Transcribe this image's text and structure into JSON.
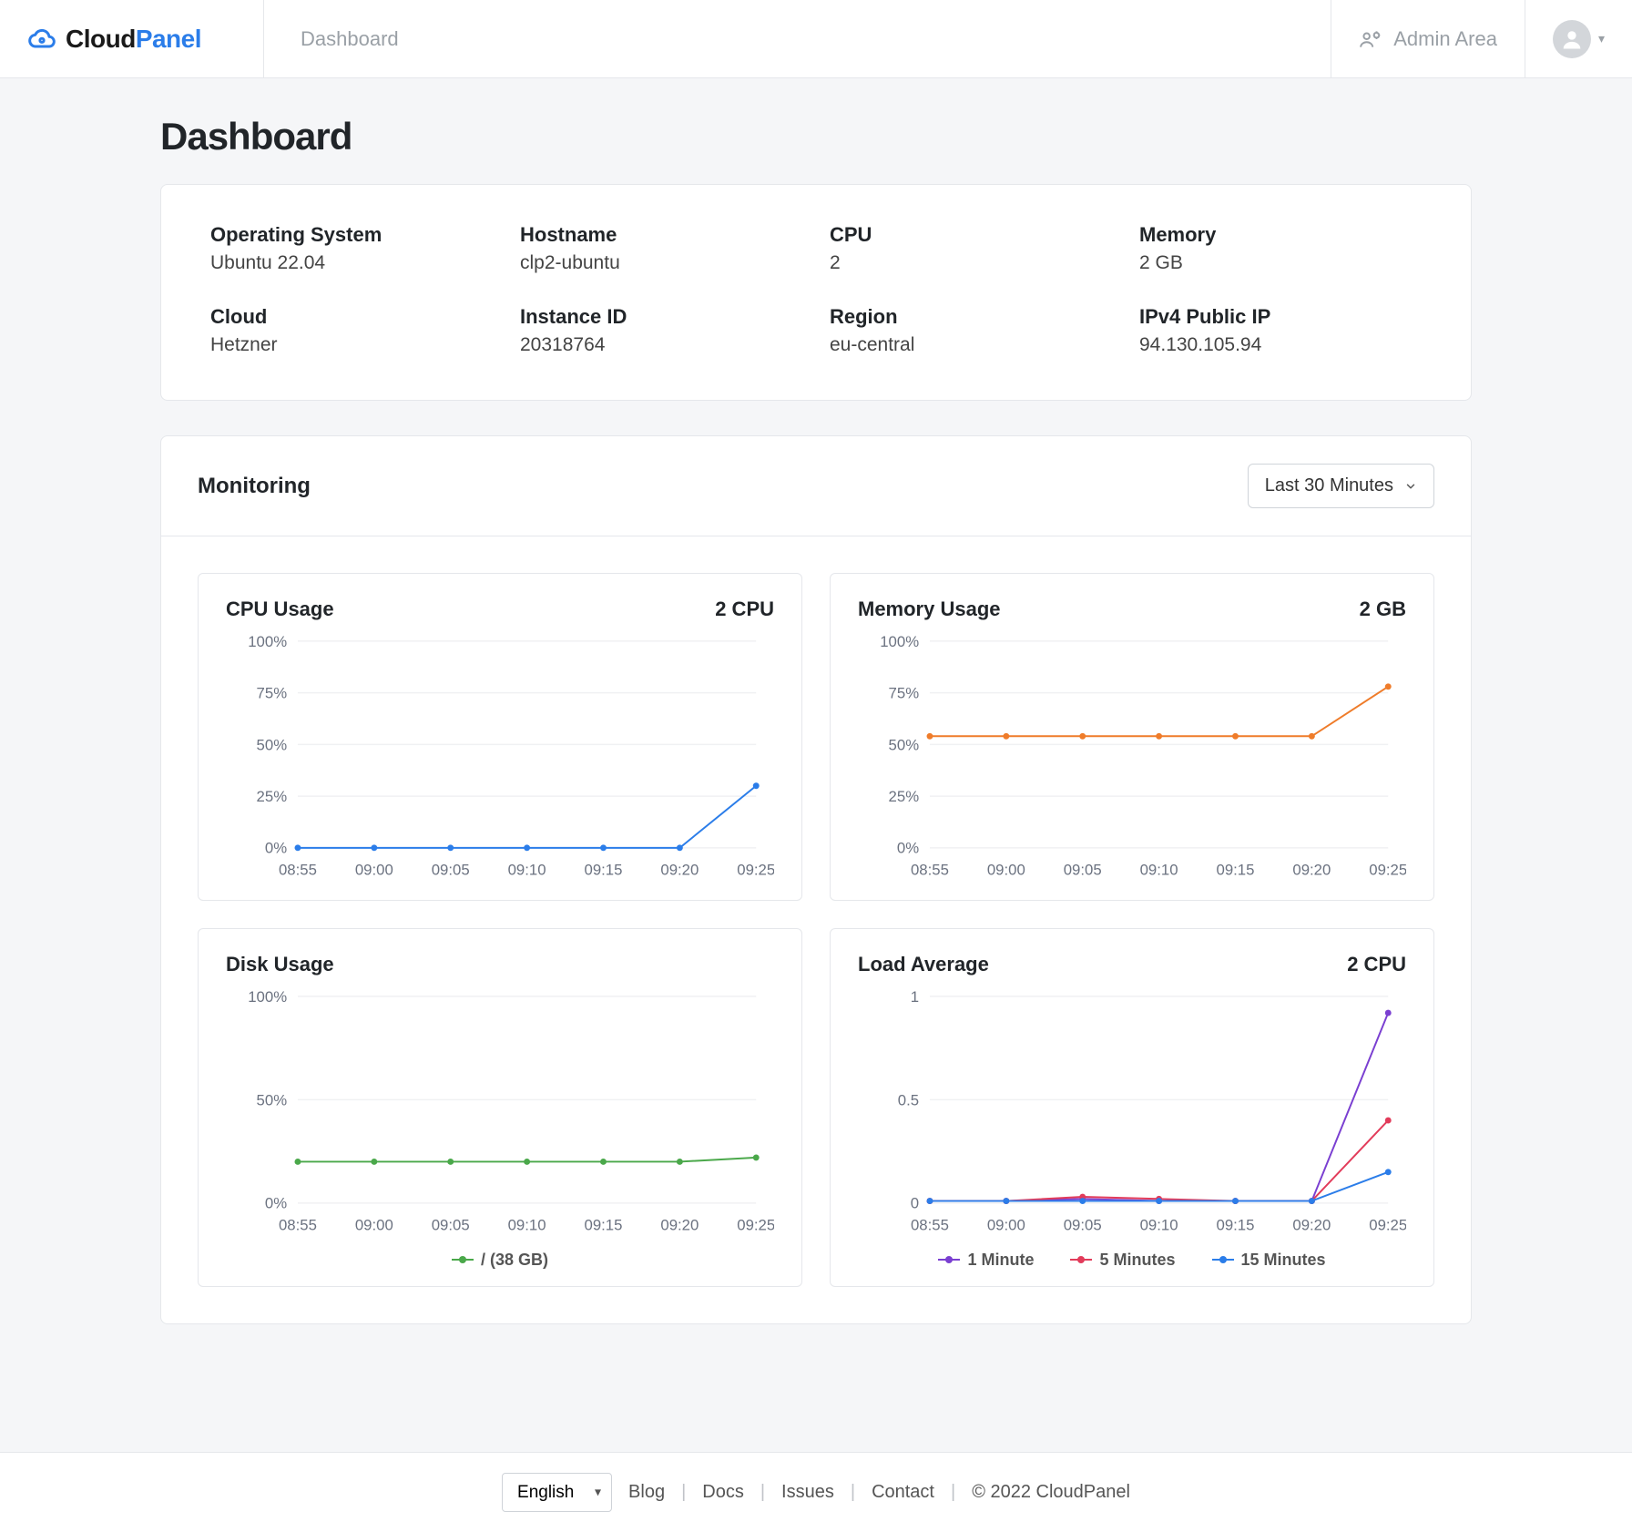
{
  "app": {
    "name_part1": "Cloud",
    "name_part2": "Panel"
  },
  "nav": {
    "dashboard": "Dashboard",
    "admin_area": "Admin Area"
  },
  "page": {
    "title": "Dashboard"
  },
  "info": {
    "os": {
      "label": "Operating System",
      "value": "Ubuntu 22.04"
    },
    "hostname": {
      "label": "Hostname",
      "value": "clp2-ubuntu"
    },
    "cpu": {
      "label": "CPU",
      "value": "2"
    },
    "memory": {
      "label": "Memory",
      "value": "2 GB"
    },
    "cloud": {
      "label": "Cloud",
      "value": "Hetzner"
    },
    "instance_id": {
      "label": "Instance ID",
      "value": "20318764"
    },
    "region": {
      "label": "Region",
      "value": "eu-central"
    },
    "public_ip": {
      "label": "IPv4 Public IP",
      "value": "94.130.105.94"
    }
  },
  "monitoring": {
    "title": "Monitoring",
    "range_label": "Last 30 Minutes",
    "x_ticks": [
      "08:55",
      "09:00",
      "09:05",
      "09:10",
      "09:15",
      "09:20",
      "09:25"
    ],
    "cpu_chart": {
      "title": "CPU Usage",
      "subtitle": "2 CPU"
    },
    "mem_chart": {
      "title": "Memory Usage",
      "subtitle": "2 GB"
    },
    "disk_chart": {
      "title": "Disk Usage",
      "legend_label": "/ (38 GB)"
    },
    "load_chart": {
      "title": "Load Average",
      "subtitle": "2 CPU",
      "legend": {
        "l1": "1 Minute",
        "l5": "5 Minutes",
        "l15": "15 Minutes"
      }
    }
  },
  "footer": {
    "lang": "English",
    "blog": "Blog",
    "docs": "Docs",
    "issues": "Issues",
    "contact": "Contact",
    "copyright": "© 2022  CloudPanel"
  },
  "chart_data": [
    {
      "id": "cpu",
      "type": "line",
      "title": "CPU Usage",
      "subtitle": "2 CPU",
      "xlabel": "",
      "ylabel": "",
      "x": [
        "08:55",
        "09:00",
        "09:05",
        "09:10",
        "09:15",
        "09:20",
        "09:25"
      ],
      "y_ticks": [
        0,
        25,
        50,
        75,
        100
      ],
      "y_tick_labels": [
        "0%",
        "25%",
        "50%",
        "75%",
        "100%"
      ],
      "ylim": [
        0,
        100
      ],
      "series": [
        {
          "name": "CPU",
          "color": "#2b7de9",
          "values": [
            0,
            0,
            0,
            0,
            0,
            0,
            30
          ]
        }
      ]
    },
    {
      "id": "memory",
      "type": "line",
      "title": "Memory Usage",
      "subtitle": "2 GB",
      "x": [
        "08:55",
        "09:00",
        "09:05",
        "09:10",
        "09:15",
        "09:20",
        "09:25"
      ],
      "y_ticks": [
        0,
        25,
        50,
        75,
        100
      ],
      "y_tick_labels": [
        "0%",
        "25%",
        "50%",
        "75%",
        "100%"
      ],
      "ylim": [
        0,
        100
      ],
      "series": [
        {
          "name": "Memory",
          "color": "#ef7c2a",
          "values": [
            54,
            54,
            54,
            54,
            54,
            54,
            78
          ]
        }
      ]
    },
    {
      "id": "disk",
      "type": "line",
      "title": "Disk Usage",
      "x": [
        "08:55",
        "09:00",
        "09:05",
        "09:10",
        "09:15",
        "09:20",
        "09:25"
      ],
      "y_ticks": [
        0,
        50,
        100
      ],
      "y_tick_labels": [
        "0%",
        "50%",
        "100%"
      ],
      "ylim": [
        0,
        100
      ],
      "series": [
        {
          "name": "/ (38 GB)",
          "color": "#4aa84a",
          "values": [
            20,
            20,
            20,
            20,
            20,
            20,
            22
          ]
        }
      ]
    },
    {
      "id": "load",
      "type": "line",
      "title": "Load Average",
      "subtitle": "2 CPU",
      "x": [
        "08:55",
        "09:00",
        "09:05",
        "09:10",
        "09:15",
        "09:20",
        "09:25"
      ],
      "y_ticks": [
        0,
        0.5,
        1
      ],
      "y_tick_labels": [
        "0",
        "0.5",
        "1"
      ],
      "ylim": [
        0,
        1
      ],
      "series": [
        {
          "name": "1 Minute",
          "color": "#7a3fd1",
          "values": [
            0.01,
            0.01,
            0.02,
            0.01,
            0.01,
            0.01,
            0.92
          ]
        },
        {
          "name": "5 Minutes",
          "color": "#e23b5a",
          "values": [
            0.01,
            0.01,
            0.03,
            0.02,
            0.01,
            0.01,
            0.4
          ]
        },
        {
          "name": "15 Minutes",
          "color": "#2b7de9",
          "values": [
            0.01,
            0.01,
            0.01,
            0.01,
            0.01,
            0.01,
            0.15
          ]
        }
      ]
    }
  ]
}
